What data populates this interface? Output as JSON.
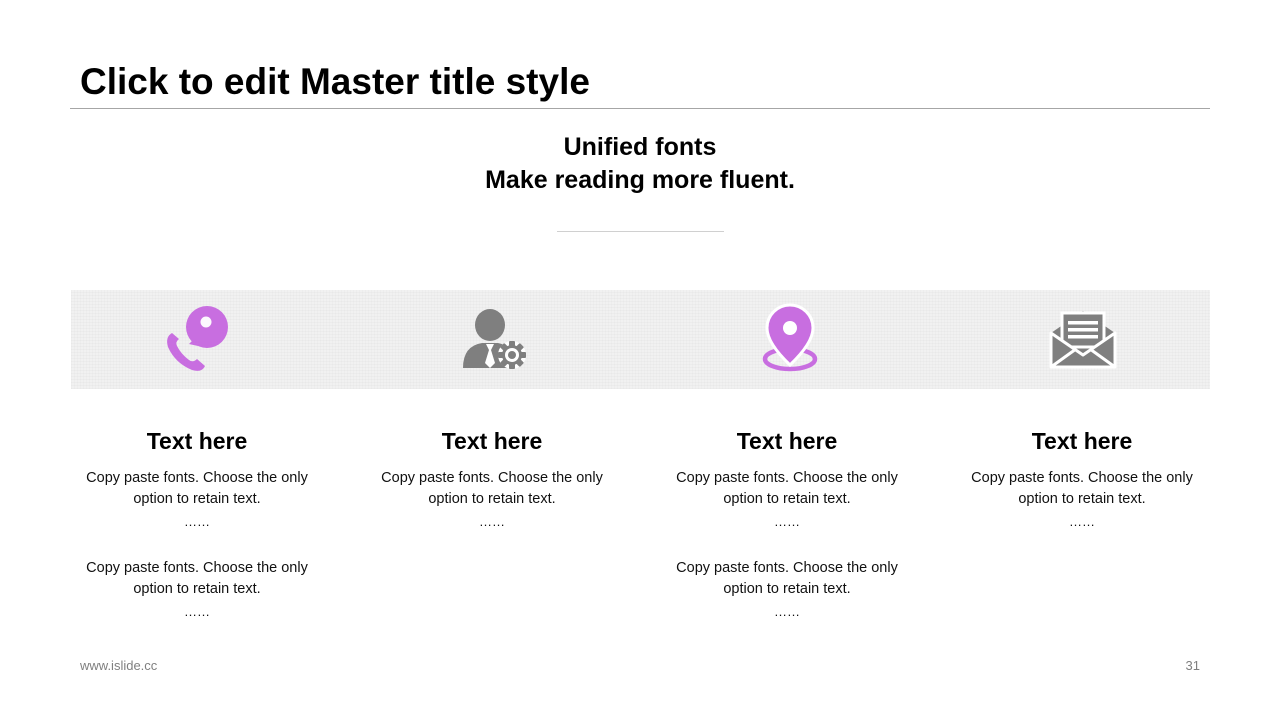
{
  "slide": {
    "title": "Click to edit Master title style",
    "subtitle_line1": "Unified fonts",
    "subtitle_line2": "Make reading more fluent.",
    "footer_url": "www.islide.cc",
    "page_number": "31"
  },
  "colors": {
    "accent": "#c86ee0",
    "icon_gray": "#7f7f7f",
    "band": "#f1f1f1"
  },
  "icons": [
    "phone-chat-icon",
    "user-settings-icon",
    "location-pin-icon",
    "mail-icon"
  ],
  "columns": [
    {
      "heading": "Text here",
      "paragraphs": [
        {
          "line1": "Copy paste fonts. Choose the only",
          "line2": "option to retain text.",
          "ellipsis": "……"
        },
        {
          "line1": "Copy paste fonts. Choose the only",
          "line2": "option to retain text.",
          "ellipsis": "……"
        }
      ]
    },
    {
      "heading": "Text here",
      "paragraphs": [
        {
          "line1": "Copy paste fonts. Choose the only",
          "line2": "option to retain text.",
          "ellipsis": "……"
        }
      ]
    },
    {
      "heading": "Text here",
      "paragraphs": [
        {
          "line1": "Copy paste fonts. Choose the only",
          "line2": "option to retain text.",
          "ellipsis": "……"
        },
        {
          "line1": "Copy paste fonts. Choose the only",
          "line2": "option to retain text.",
          "ellipsis": "……"
        }
      ]
    },
    {
      "heading": "Text here",
      "paragraphs": [
        {
          "line1": "Copy paste fonts. Choose the only",
          "line2": "option to retain text.",
          "ellipsis": "……"
        }
      ]
    }
  ]
}
